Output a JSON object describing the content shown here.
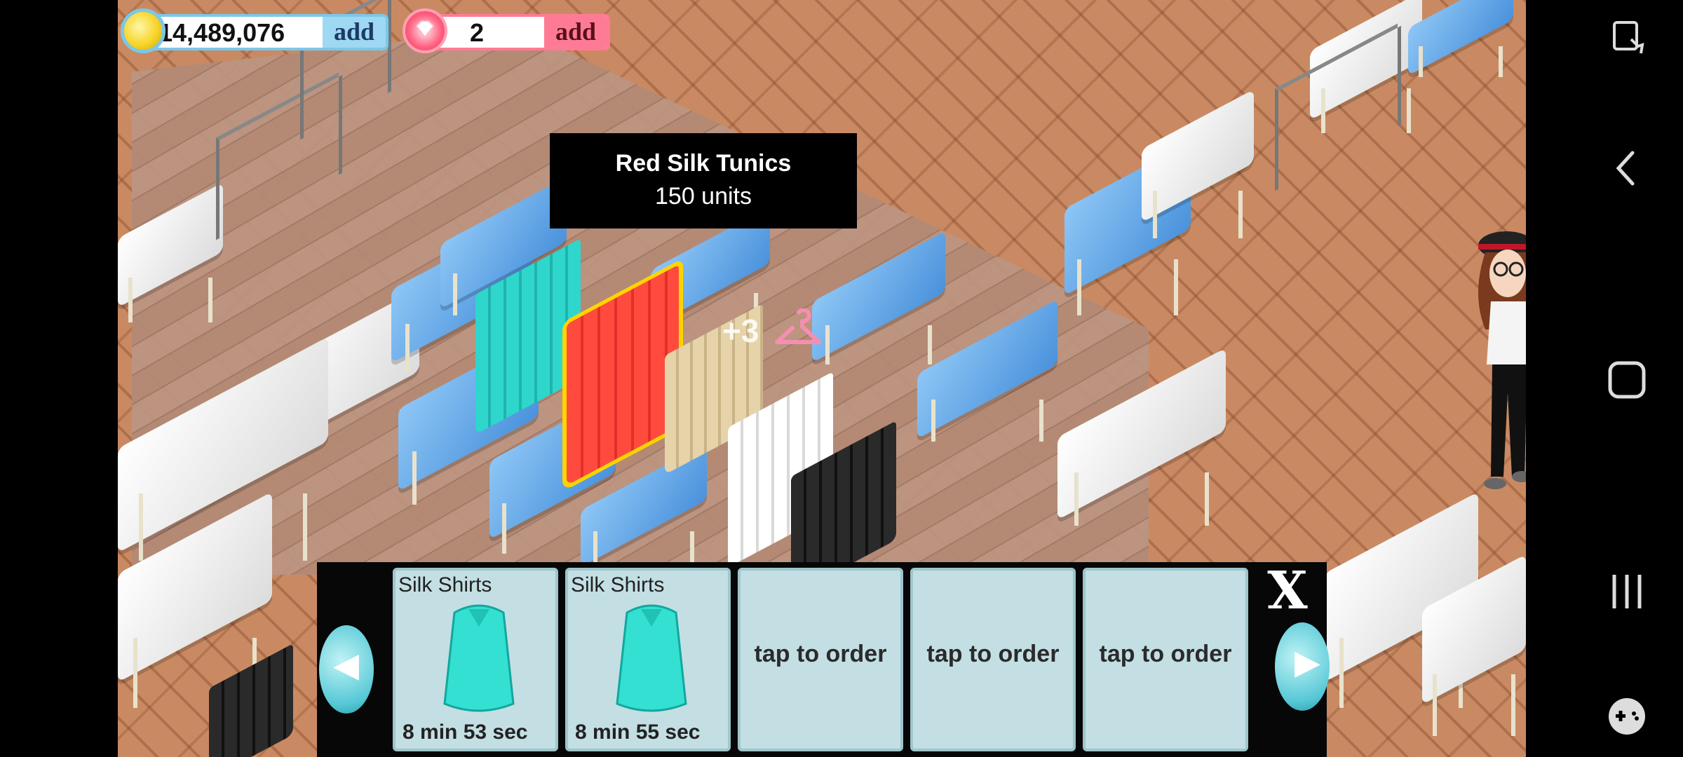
{
  "hud": {
    "coins": {
      "value": "14,489,076",
      "add_label": "add"
    },
    "gems": {
      "value": "2",
      "add_label": "add"
    }
  },
  "tooltip": {
    "title": "Red Silk Tunics",
    "subtitle": "150 units"
  },
  "floating_reward": "+3",
  "order_panel": {
    "slots": [
      {
        "title": "Silk Shirts",
        "timer": "8 min 53 sec"
      },
      {
        "title": "Silk Shirts",
        "timer": "8 min 55 sec"
      },
      {
        "tap_label": "tap to order"
      },
      {
        "tap_label": "tap to order"
      },
      {
        "tap_label": "tap to order"
      }
    ],
    "close_label": "X"
  },
  "colors": {
    "coin_border": "#7cc7e8",
    "gem_border": "#ff7b95",
    "slot_bg": "#c3dfe4",
    "highlight": "#ffd400"
  }
}
